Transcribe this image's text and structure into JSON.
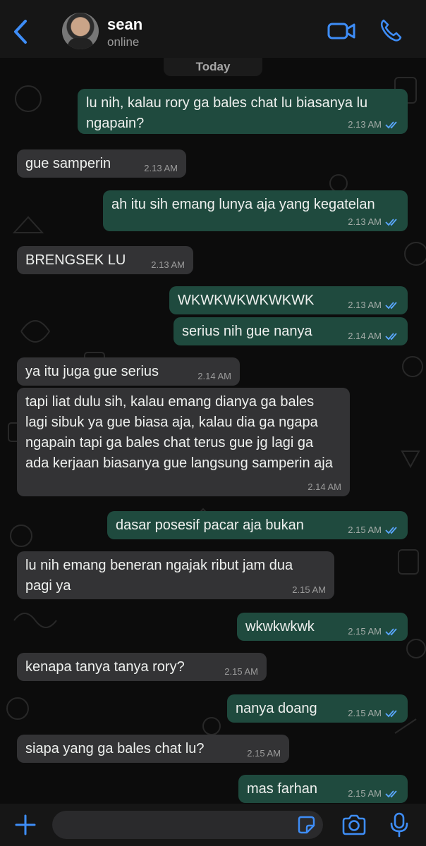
{
  "header": {
    "contact_name": "sean",
    "status": "online",
    "accent_color": "#3e8df7"
  },
  "date_separator": "Today",
  "messages": [
    {
      "direction": "out",
      "text": "lu nih, kalau rory ga bales chat lu biasanya lu ngapain?",
      "time": "2.13 AM",
      "read": true
    },
    {
      "direction": "in",
      "text": "gue samperin",
      "time": "2.13 AM"
    },
    {
      "direction": "out",
      "text": "ah itu sih emang lunya aja yang kegatelan",
      "time": "2.13 AM",
      "read": true
    },
    {
      "direction": "in",
      "text": "BRENGSEK LU",
      "time": "2.13 AM"
    },
    {
      "direction": "out",
      "text": "WKWKWKWKWKWK",
      "time": "2.13 AM",
      "read": true
    },
    {
      "direction": "out",
      "text": "serius nih gue nanya",
      "time": "2.14 AM",
      "read": true
    },
    {
      "direction": "in",
      "text": "ya itu juga gue serius",
      "time": "2.14 AM"
    },
    {
      "direction": "in",
      "text": "tapi liat dulu sih, kalau emang dianya ga bales lagi sibuk ya gue biasa aja, kalau dia ga ngapa ngapain tapi ga bales chat terus gue jg lagi ga ada kerjaan biasanya gue langsung samperin aja",
      "time": "2.14 AM"
    },
    {
      "direction": "out",
      "text": "dasar posesif pacar aja bukan",
      "time": "2.15 AM",
      "read": true
    },
    {
      "direction": "in",
      "text": "lu nih emang beneran ngajak ribut jam dua pagi ya",
      "time": "2.15 AM"
    },
    {
      "direction": "out",
      "text": "wkwkwkwk",
      "time": "2.15 AM",
      "read": true
    },
    {
      "direction": "in",
      "text": "kenapa tanya tanya rory?",
      "time": "2.15 AM"
    },
    {
      "direction": "out",
      "text": "nanya doang",
      "time": "2.15 AM",
      "read": true
    },
    {
      "direction": "in",
      "text": "siapa yang ga bales chat lu?",
      "time": "2.15 AM"
    },
    {
      "direction": "out",
      "text": "mas farhan",
      "time": "2.15 AM",
      "read": true
    }
  ],
  "composer": {
    "input_value": ""
  },
  "colors": {
    "outgoing_bubble": "#1f4a3e",
    "incoming_bubble": "#333335",
    "read_ticks": "#5aa7ff"
  }
}
